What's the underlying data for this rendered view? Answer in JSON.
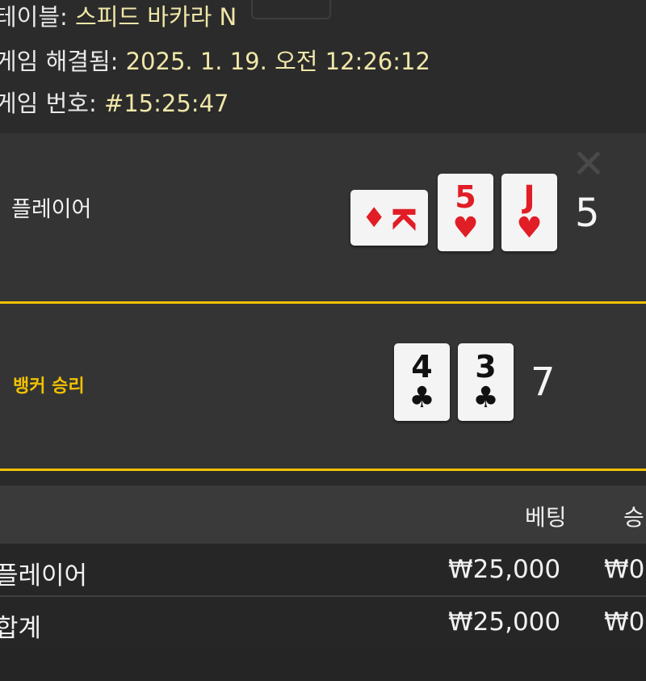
{
  "header": {
    "table_label": "테이블: ",
    "table_value": "스피드 바카라 N",
    "resolved_label": "게임 해결됨: ",
    "resolved_value": "2025. 1. 19. 오전 12:26:12",
    "game_no_label": "게임 번호: ",
    "game_no_value": "#15:25:47"
  },
  "player": {
    "label": "플레이어",
    "score": "5",
    "cards": [
      {
        "rank": "K",
        "suit": "♦",
        "color": "#e11d26"
      },
      {
        "rank": "5",
        "suit": "♥",
        "color": "#e11d26"
      },
      {
        "rank": "J",
        "suit": "♥",
        "color": "#e11d26"
      }
    ]
  },
  "banker": {
    "label": "뱅커 승리",
    "score": "7",
    "cards": [
      {
        "rank": "4",
        "suit": "♣",
        "color": "#111111"
      },
      {
        "rank": "3",
        "suit": "♣",
        "color": "#111111"
      }
    ]
  },
  "table": {
    "col_bet": "베팅",
    "col_win": "승",
    "rows": [
      {
        "name": "플레이어",
        "bet": "₩25,000",
        "win": "₩0"
      },
      {
        "name": "합계",
        "bet": "₩25,000",
        "win": "₩0"
      }
    ]
  },
  "colors": {
    "accent": "#f2c200",
    "red_suit": "#e11d26",
    "black_suit": "#111111"
  },
  "icons": {
    "close": "close-icon"
  }
}
